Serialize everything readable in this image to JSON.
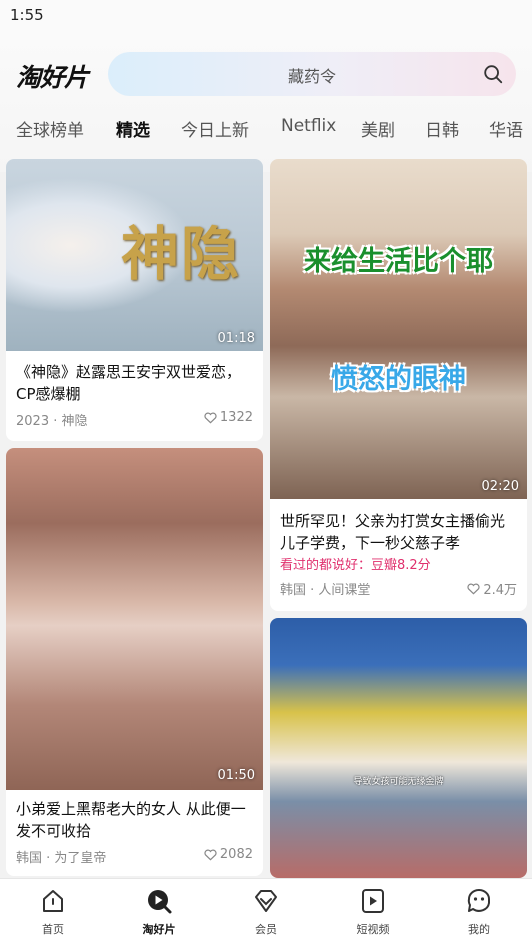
{
  "status_bar": {
    "time": "1:55"
  },
  "header": {
    "logo": "淘好片",
    "search_placeholder": "藏药令"
  },
  "tabs": [
    {
      "label": "全球榜单",
      "active": false
    },
    {
      "label": "精选",
      "active": true
    },
    {
      "label": "今日上新",
      "active": false
    },
    {
      "label": "Netflix",
      "active": false
    },
    {
      "label": "美剧",
      "active": false
    },
    {
      "label": "日韩",
      "active": false
    },
    {
      "label": "华语",
      "active": false
    }
  ],
  "cards": [
    {
      "duration": "01:18",
      "overlay_text": "神隐",
      "title": "《神隐》赵露思王安宇双世爱恋，CP感爆棚",
      "meta": "2023 · 神隐",
      "likes": "1322"
    },
    {
      "duration": "01:50",
      "title": "小弟爱上黑帮老大的女人 从此便一发不可收拾",
      "meta": "韩国 · 为了皇帝",
      "likes": "2082"
    },
    {
      "duration": "02:20",
      "overlay_text_1": "来给生活比个耶",
      "overlay_text_2": "愤怒的眼神",
      "title": "世所罕见！父亲为打赏女主播偷光儿子学费，下一秒父慈子孝",
      "hint": "看过的都说好：豆瓣8.2分",
      "meta": "韩国 · 人间课堂",
      "likes": "2.4万"
    },
    {
      "subtitle": "导致女孩可能无缘金牌"
    }
  ],
  "bottom_nav": [
    {
      "label": "首页",
      "icon": "home-icon",
      "active": false
    },
    {
      "label": "淘好片",
      "icon": "play-search-icon",
      "active": true
    },
    {
      "label": "会员",
      "icon": "vip-diamond-icon",
      "active": false
    },
    {
      "label": "短视频",
      "icon": "short-video-icon",
      "active": false
    },
    {
      "label": "我的",
      "icon": "profile-icon",
      "active": false
    }
  ],
  "colors": {
    "accent_pink": "#e0306e",
    "card_bg": "#ffffff",
    "page_bg": "#f2f2f2"
  }
}
